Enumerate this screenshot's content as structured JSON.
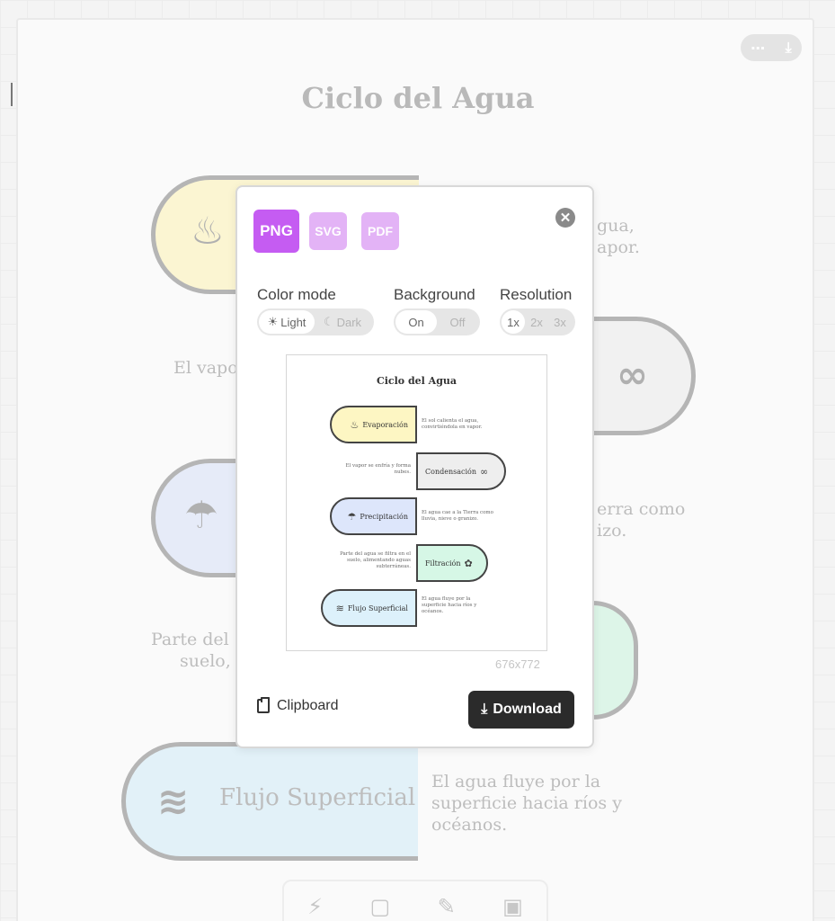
{
  "app": {
    "top_actions": {
      "more_icon": "more-dots-icon",
      "download_icon": "download-icon"
    }
  },
  "background": {
    "title": "Ciclo del Agua",
    "texts": [
      "gua,",
      "apor.",
      "El vapo",
      "erra como",
      "izo.",
      "Parte del",
      "suelo,",
      "Flujo Superficial",
      "El agua fluye por la",
      "superficie hacia ríos y",
      "océanos."
    ]
  },
  "export_modal": {
    "formats": [
      "PNG",
      "SVG",
      "PDF"
    ],
    "selected_format": "PNG",
    "close_icon": "close-icon",
    "color_mode": {
      "label": "Color mode",
      "options": [
        "Light",
        "Dark"
      ],
      "selected": "Light"
    },
    "background": {
      "label": "Background",
      "options": [
        "On",
        "Off"
      ],
      "selected": "On"
    },
    "resolution": {
      "label": "Resolution",
      "options": [
        "1x",
        "2x",
        "3x"
      ],
      "selected": "1x"
    },
    "preview": {
      "title": "Ciclo del Agua",
      "steps": [
        {
          "name": "Evaporación",
          "desc": "El sol calienta el agua, convirtiéndola en vapor.",
          "color": "#fdf6c3"
        },
        {
          "name": "Condensación",
          "desc": "El vapor se enfría y forma nubes.",
          "color": "#eeeeee"
        },
        {
          "name": "Precipitación",
          "desc": "El agua cae a la Tierra como lluvia, nieve o granizo.",
          "color": "#dde6fb"
        },
        {
          "name": "Filtración",
          "desc": "Parte del agua se filtra en el suelo, alimentando aguas subterráneas.",
          "color": "#d6f7e6"
        },
        {
          "name": "Flujo Superficial",
          "desc": "El agua fluye por la superficie hacia ríos y océanos.",
          "color": "#ddf1fb"
        }
      ]
    },
    "dimensions": "676x772",
    "clipboard_label": "Clipboard",
    "download_label": "Download"
  },
  "colors": {
    "format_active": "#c55cf2",
    "format_inactive": "#e3b3f6",
    "download_bg": "#2b2b2b"
  }
}
